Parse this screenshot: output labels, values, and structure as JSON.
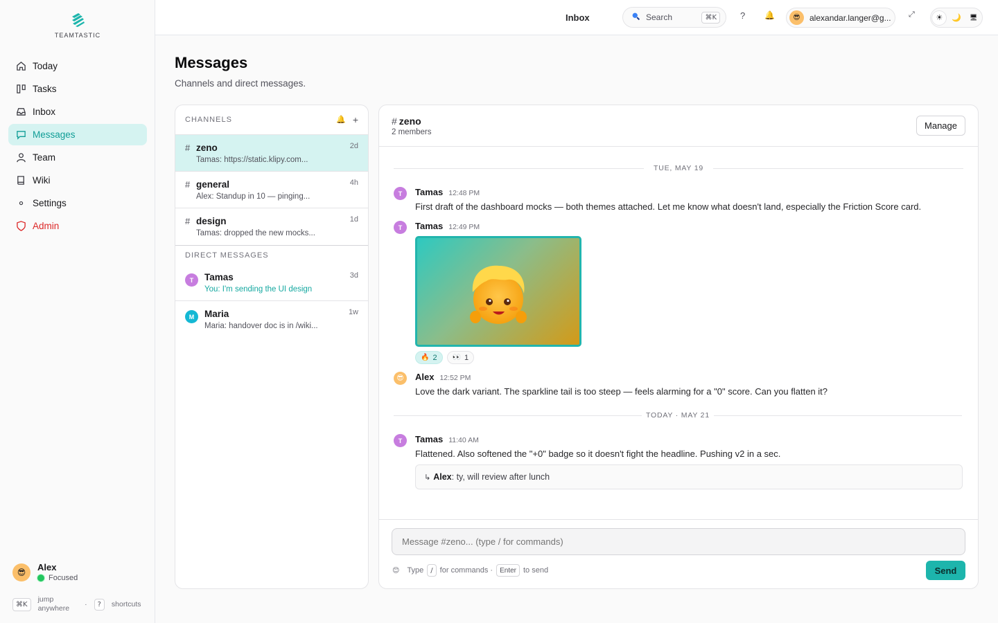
{
  "app": {
    "brand": "TEAMTASTIC",
    "accent": "#1db5ac"
  },
  "sidebar": {
    "items": [
      {
        "label": "Today",
        "icon": "home-icon"
      },
      {
        "label": "Tasks",
        "icon": "kanban-icon"
      },
      {
        "label": "Inbox",
        "icon": "inbox-icon"
      },
      {
        "label": "Messages",
        "icon": "chat-bubble-icon",
        "active": true
      },
      {
        "label": "Team",
        "icon": "user-icon"
      },
      {
        "label": "Wiki",
        "icon": "book-icon"
      },
      {
        "label": "Settings",
        "icon": "dot-icon"
      },
      {
        "label": "Admin",
        "icon": "shield-icon",
        "color": "#dc2626"
      }
    ],
    "user": {
      "name": "Alex",
      "status": "Focused",
      "avatar": "😎"
    },
    "shortcuts": {
      "jump_key": "⌘K",
      "jump_label_1": "jump",
      "jump_label_2": "anywhere",
      "sep": "·",
      "help_key": "?",
      "help_label": "shortcuts"
    }
  },
  "topbar": {
    "title": "Inbox",
    "search_label": "Search",
    "search_key": "⌘K",
    "help": "?",
    "bell": "🔔",
    "account_avatar": "😎",
    "account_email": "alexandar.langer@g...",
    "expand": "⤢",
    "theme": {
      "light": "☀",
      "dark": "🌙",
      "system": "🖥"
    }
  },
  "page": {
    "title": "Messages",
    "subtitle": "Channels and direct messages."
  },
  "channels": {
    "header": "CHANNELS",
    "bell": "🔔",
    "add": "+",
    "hash": "#",
    "list": [
      {
        "name": "zeno",
        "age": "2d",
        "preview": "Tamas: https://static.klipy.com...",
        "active": true
      },
      {
        "name": "general",
        "age": "4h",
        "preview": "Alex: Standup in 10 — pinging..."
      },
      {
        "name": "design",
        "age": "1d",
        "preview": "Tamas: dropped the new mocks..."
      }
    ],
    "dm_header": "DIRECT MESSAGES",
    "dms": [
      {
        "initial": "T",
        "name": "Tamas",
        "age": "3d",
        "preview": "You: I'm sending the UI design",
        "color": "#c77ddf"
      },
      {
        "initial": "M",
        "name": "Maria",
        "age": "1w",
        "preview": "Maria: handover doc is in /wiki...",
        "color": "#14b8d4"
      }
    ]
  },
  "conversation": {
    "hash": "#",
    "channel": "zeno",
    "members": "2 members",
    "manage_label": "Manage",
    "dividers": [
      "TUE, MAY 19",
      "TODAY · MAY 21"
    ],
    "messages": [
      {
        "initial": "T",
        "author": "Tamas",
        "time": "12:48 PM",
        "body": "First draft of the dashboard mocks — both themes attached. Let me know what doesn't land, especially the Friction Score card."
      },
      {
        "initial": "T",
        "author": "Tamas",
        "time": "12:49 PM",
        "body": ""
      },
      {
        "initial": "😎",
        "author": "Alex",
        "time": "12:52 PM",
        "body": "Love the dark variant. The sparkline tail is too steep — feels alarming for a \"0\" score. Can you flatten it?"
      },
      {
        "initial": "T",
        "author": "Tamas",
        "time": "11:40 AM",
        "body": "Flattened. Also softened the \"+0\" badge so it doesn't fight the headline. Pushing v2 in a sec."
      }
    ],
    "reactions": [
      {
        "emoji": "🔥",
        "count": "2",
        "mine": true
      },
      {
        "emoji": "👀",
        "count": "1",
        "mine": false
      }
    ],
    "reply": {
      "arrow": "↳",
      "author": "Alex",
      "text": ": ty, will review after lunch"
    },
    "tamas_color": "#c77ddf",
    "alex_color": "#fbbf6a"
  },
  "composer": {
    "placeholder": "Message #zeno... (type / for commands)",
    "emoji": "😊",
    "hint_type": "Type",
    "hint_slash": "/",
    "hint_commands": "for commands ·",
    "hint_enter": "Enter",
    "hint_send": "to send",
    "send_label": "Send"
  }
}
